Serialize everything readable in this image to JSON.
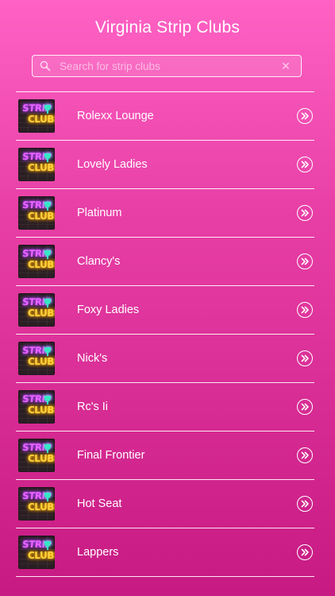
{
  "header": {
    "title": "Virginia Strip Clubs"
  },
  "search": {
    "placeholder": "Search for strip clubs",
    "value": "",
    "clear_glyph": "✕"
  },
  "thumbnail": {
    "line1": "STRIP",
    "line2": "CLUBS"
  },
  "icons": {
    "search": "search-icon",
    "clear": "close-icon",
    "row_action": "double-chevron-right-icon"
  },
  "colors": {
    "background_top": "#ff62c4",
    "background_bottom": "#c71a82",
    "text": "#ffffff"
  },
  "clubs": [
    {
      "name": "Rolexx Lounge"
    },
    {
      "name": "Lovely Ladies"
    },
    {
      "name": "Platinum"
    },
    {
      "name": "Clancy's"
    },
    {
      "name": "Foxy Ladies"
    },
    {
      "name": "Nick's"
    },
    {
      "name": "Rc's Ii"
    },
    {
      "name": "Final Frontier"
    },
    {
      "name": "Hot Seat"
    },
    {
      "name": "Lappers"
    }
  ]
}
